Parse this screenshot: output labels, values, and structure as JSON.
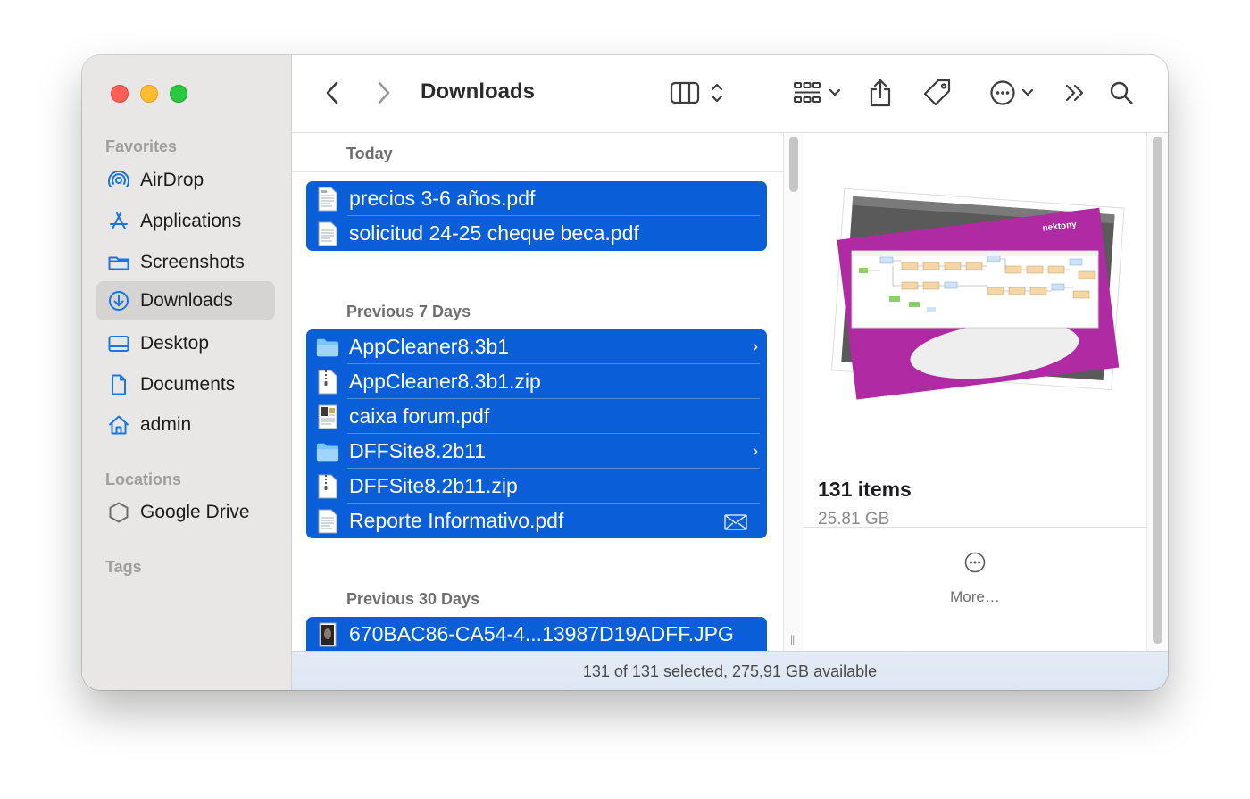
{
  "window": {
    "title": "Downloads"
  },
  "sidebar": {
    "sections": [
      {
        "title": "Favorites",
        "items": [
          {
            "label": "AirDrop",
            "icon": "airdrop-icon"
          },
          {
            "label": "Applications",
            "icon": "applications-icon"
          },
          {
            "label": "Screenshots",
            "icon": "folder-icon"
          },
          {
            "label": "Downloads",
            "icon": "download-icon",
            "active": true
          },
          {
            "label": "Desktop",
            "icon": "desktop-icon"
          },
          {
            "label": "Documents",
            "icon": "document-icon"
          },
          {
            "label": "admin",
            "icon": "home-icon"
          }
        ]
      },
      {
        "title": "Locations",
        "items": [
          {
            "label": "Google Drive",
            "icon": "hexagon-icon"
          }
        ]
      },
      {
        "title": "Tags",
        "items": []
      }
    ]
  },
  "toolbar": {
    "icons": [
      "back-icon",
      "forward-icon",
      "column-view-icon",
      "group-icon",
      "share-icon",
      "tag-icon",
      "more-actions-icon",
      "expand-toolbar-icon",
      "search-icon"
    ]
  },
  "file_groups": [
    {
      "title": "Today",
      "files": [
        {
          "name": "precios 3-6 años.pdf",
          "kind": "pdf"
        },
        {
          "name": "solicitud 24-25 cheque beca.pdf",
          "kind": "pdf"
        }
      ]
    },
    {
      "title": "Previous 7 Days",
      "files": [
        {
          "name": "AppCleaner8.3b1",
          "kind": "folder"
        },
        {
          "name": "AppCleaner8.3b1.zip",
          "kind": "zip"
        },
        {
          "name": "caixa forum.pdf",
          "kind": "pdf-image"
        },
        {
          "name": "DFFSite8.2b11",
          "kind": "folder"
        },
        {
          "name": "DFFSite8.2b11.zip",
          "kind": "zip"
        },
        {
          "name": "Reporte Informativo.pdf",
          "kind": "pdf"
        }
      ]
    },
    {
      "title": "Previous 30 Days",
      "files": [
        {
          "name": "670BAC86-CA54-4...13987D19ADFF.JPG",
          "kind": "image"
        }
      ]
    }
  ],
  "preview": {
    "count": "131 items",
    "size": "25.81 GB",
    "more_label": "More…",
    "thumbnail_brand": "nektony"
  },
  "status": {
    "text": "131 of 131 selected, 275,91 GB available"
  },
  "colors": {
    "selection": "#0a5fd8",
    "sidebar_bg": "#e9e7e6",
    "accent": "#1a73e8"
  }
}
